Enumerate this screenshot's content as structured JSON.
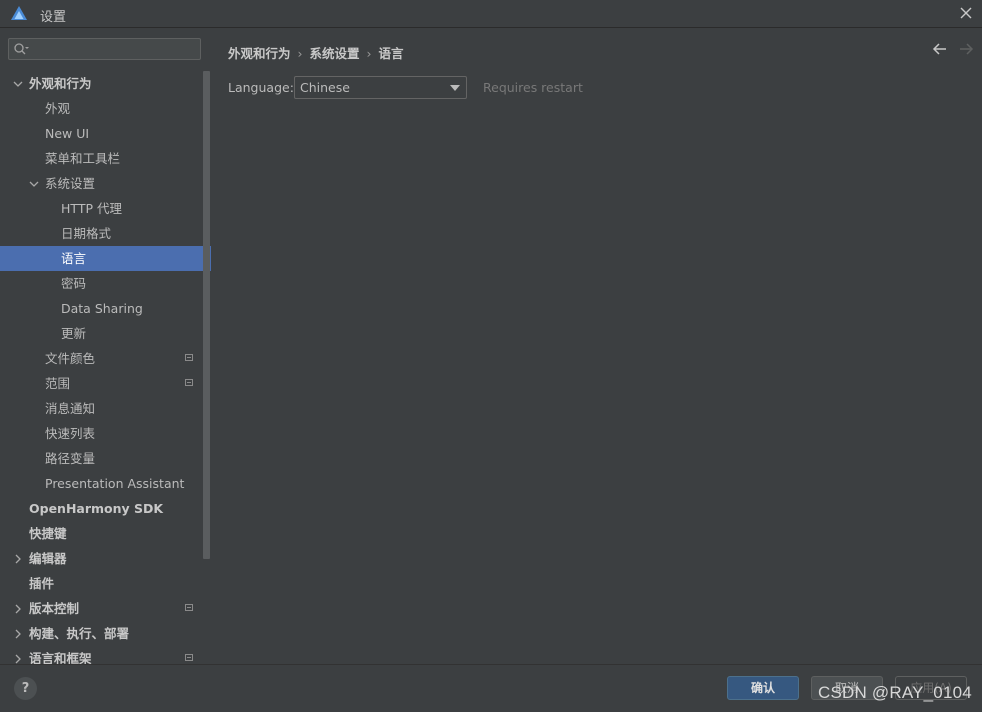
{
  "window": {
    "title": "设置",
    "close_icon": "close-icon",
    "logo_icon": "app-logo-icon"
  },
  "sidebar": {
    "search": {
      "value": "",
      "placeholder": "",
      "icon": "search-icon"
    },
    "items": [
      {
        "label": "外观和行为",
        "level": 0,
        "bold": true,
        "arrow": "expanded"
      },
      {
        "label": "外观",
        "level": 1
      },
      {
        "label": "New UI",
        "level": 1
      },
      {
        "label": "菜单和工具栏",
        "level": 1
      },
      {
        "label": "系统设置",
        "level": 1,
        "arrow": "expanded"
      },
      {
        "label": "HTTP 代理",
        "level": 2
      },
      {
        "label": "日期格式",
        "level": 2
      },
      {
        "label": "语言",
        "level": 2,
        "selected": true
      },
      {
        "label": "密码",
        "level": 2
      },
      {
        "label": "Data Sharing",
        "level": 2
      },
      {
        "label": "更新",
        "level": 2
      },
      {
        "label": "文件颜色",
        "level": 1,
        "badge": true
      },
      {
        "label": "范围",
        "level": 1,
        "badge": true
      },
      {
        "label": "消息通知",
        "level": 1
      },
      {
        "label": "快速列表",
        "level": 1
      },
      {
        "label": "路径变量",
        "level": 1
      },
      {
        "label": "Presentation Assistant",
        "level": 1
      },
      {
        "label": "OpenHarmony SDK",
        "level": 0,
        "bold": true
      },
      {
        "label": "快捷键",
        "level": 0,
        "bold": true
      },
      {
        "label": "编辑器",
        "level": 0,
        "bold": true,
        "arrow": "collapsed"
      },
      {
        "label": "插件",
        "level": 0,
        "bold": true
      },
      {
        "label": "版本控制",
        "level": 0,
        "bold": true,
        "arrow": "collapsed",
        "badge": true
      },
      {
        "label": "构建、执行、部署",
        "level": 0,
        "bold": true,
        "arrow": "collapsed"
      },
      {
        "label": "语言和框架",
        "level": 0,
        "bold": true,
        "arrow": "collapsed",
        "badge": true
      }
    ]
  },
  "content": {
    "breadcrumb": [
      "外观和行为",
      "系统设置",
      "语言"
    ],
    "language_label": "Language:",
    "language_value": "Chinese",
    "restart_hint": "Requires restart"
  },
  "footer": {
    "help_label": "?",
    "ok_label": "确认",
    "cancel_label": "取消",
    "apply_label": "应用(A)",
    "watermark": "CSDN @RAY_0104"
  },
  "colors": {
    "background": "#3c3f41",
    "selection": "#4b6eaf",
    "primary_button": "#365880"
  }
}
